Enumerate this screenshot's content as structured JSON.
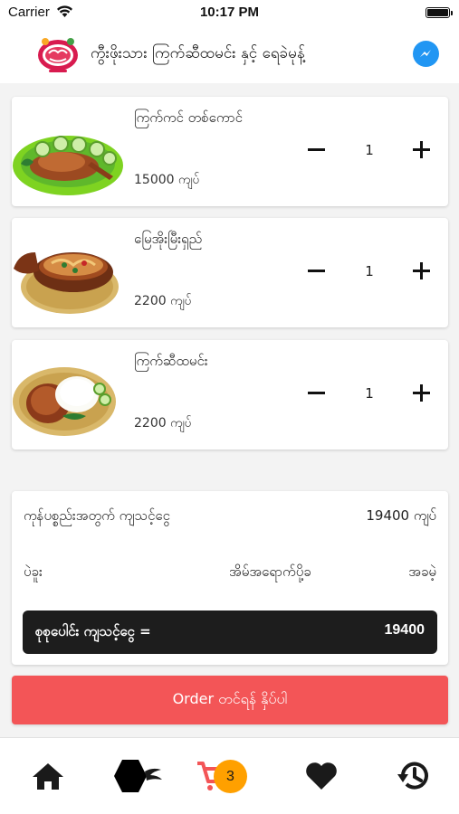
{
  "status_bar": {
    "carrier": "Carrier",
    "time": "10:17 PM"
  },
  "header": {
    "title": "ကွီးဖိုးသား ကြက်ဆီထမင်း နှင့် ရေခဲမုန့်"
  },
  "cart_items": [
    {
      "name": "ကြက်ကင် တစ်ကောင်",
      "price": "15000 ကျပ်",
      "quantity": "1"
    },
    {
      "name": "မြေအိုးမြီးရှည်",
      "price": "2200 ကျပ်",
      "quantity": "1"
    },
    {
      "name": "ကြက်ဆီထမင်း",
      "price": "2200 ကျပ်",
      "quantity": "1"
    }
  ],
  "summary": {
    "subtotal_label": "ကုန်ပစ္စည်းအတွက် ကျသင့်ငွေ",
    "subtotal_value": "19400 ကျပ်",
    "delivery_label": "ပဲခူး",
    "delivery_option": "အိမ်အရောက်ပို့ခ",
    "delivery_fee": "အခမဲ့",
    "total_label": "စုစုပေါင်း ကျသင့်ငွေ   =",
    "total_value": "19400"
  },
  "order_button": {
    "label": "Order တင်ရန် နှိပ်ပါ"
  },
  "bottom_nav": {
    "cart_badge": "3"
  },
  "colors": {
    "accent_red": "#f35557",
    "badge_orange": "#ffa000",
    "total_bar": "#1d1d1d",
    "messenger_blue": "#2196f3"
  }
}
